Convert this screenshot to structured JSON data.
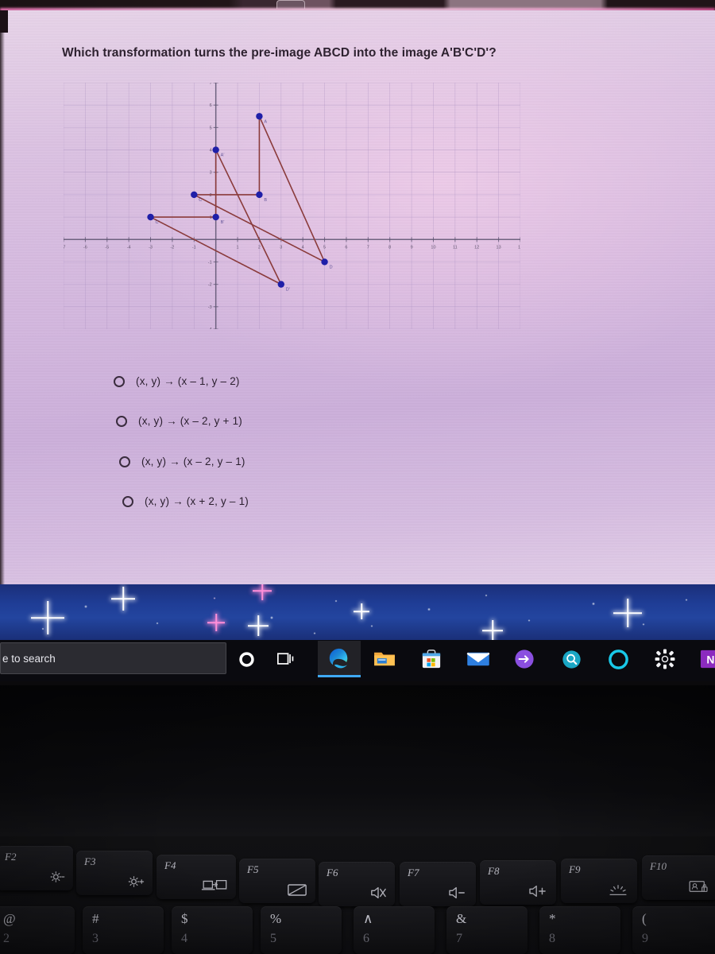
{
  "browser": {
    "tab_strip_visible": true
  },
  "question": {
    "title": "Which transformation turns the pre-image ABCD into the image A'B'C'D'?",
    "choices": [
      {
        "label": "(x, y) → (x – 1, y – 2)",
        "selected": false
      },
      {
        "label": "(x, y) → (x – 2, y + 1)",
        "selected": false
      },
      {
        "label": "(x, y) → (x – 2, y – 1)",
        "selected": false
      },
      {
        "label": "(x, y) → (x + 2, y – 1)",
        "selected": false
      }
    ]
  },
  "chart_data": {
    "type": "scatter",
    "title": "",
    "xlabel": "",
    "ylabel": "",
    "xlim": [
      -7,
      14
    ],
    "ylim": [
      -4,
      7
    ],
    "grid": true,
    "grid_step": 1,
    "legend": "none",
    "x_ticks": [
      -7,
      -6,
      -5,
      -4,
      -3,
      -2,
      -1,
      0,
      1,
      2,
      3,
      4,
      5,
      6,
      7,
      8,
      9,
      10,
      11,
      12,
      13,
      14
    ],
    "y_ticks": [
      -4,
      -3,
      -2,
      -1,
      0,
      1,
      2,
      3,
      4,
      5,
      6,
      7
    ],
    "point_color": "#1f1fa8",
    "segment_color": "#8a3b3b",
    "axis_color": "#5d5470",
    "grid_color": "#a98fc0",
    "series": [
      {
        "name": "pre-image ABCD",
        "points": [
          {
            "label": "A",
            "x": 2,
            "y": 5.5
          },
          {
            "label": "B",
            "x": 2,
            "y": 2
          },
          {
            "label": "C",
            "x": -1,
            "y": 2
          },
          {
            "label": "D",
            "x": 5,
            "y": -1
          }
        ],
        "edges": [
          [
            "A",
            "B"
          ],
          [
            "B",
            "C"
          ],
          [
            "A",
            "D"
          ],
          [
            "C",
            "D"
          ]
        ]
      },
      {
        "name": "image A'B'C'D'",
        "points": [
          {
            "label": "A'",
            "x": 0,
            "y": 4
          },
          {
            "label": "B'",
            "x": 0,
            "y": 1
          },
          {
            "label": "C'",
            "x": -3,
            "y": 1
          },
          {
            "label": "D'",
            "x": 3,
            "y": -2
          }
        ],
        "edges": [
          [
            "A'",
            "B'"
          ],
          [
            "B'",
            "C'"
          ],
          [
            "A'",
            "D'"
          ],
          [
            "C'",
            "D'"
          ]
        ]
      }
    ]
  },
  "taskbar": {
    "search_placeholder": "e to search",
    "search_value": "",
    "items": [
      {
        "name": "cortana-icon",
        "label": "Cortana"
      },
      {
        "name": "task-view-icon",
        "label": "Task View"
      },
      {
        "name": "edge-icon",
        "label": "Microsoft Edge"
      },
      {
        "name": "file-explorer-icon",
        "label": "File Explorer"
      },
      {
        "name": "microsoft-store-icon",
        "label": "Microsoft Store"
      },
      {
        "name": "mail-icon",
        "label": "Mail"
      },
      {
        "name": "sync-icon",
        "label": "Sync"
      },
      {
        "name": "search-magnifier-icon",
        "label": "Search"
      },
      {
        "name": "cortana-ring-icon",
        "label": "Cortana Ring"
      },
      {
        "name": "settings-gear-icon",
        "label": "Settings"
      },
      {
        "name": "onenote-icon",
        "label": "N"
      }
    ],
    "active_app": "Microsoft Edge"
  },
  "keyboard": {
    "function_keys": [
      {
        "key": "F2",
        "glyph": "brightness-down"
      },
      {
        "key": "F3",
        "glyph": "brightness-up"
      },
      {
        "key": "F4",
        "glyph": "display-switch"
      },
      {
        "key": "F5",
        "glyph": "touchpad-toggle"
      },
      {
        "key": "F6",
        "glyph": "volume-mute"
      },
      {
        "key": "F7",
        "glyph": "volume-down"
      },
      {
        "key": "F8",
        "glyph": "volume-up"
      },
      {
        "key": "F9",
        "glyph": "keyboard-backlight"
      },
      {
        "key": "F10",
        "glyph": "privacy-screen"
      }
    ],
    "number_row": [
      {
        "symbol": "@",
        "digit": "2"
      },
      {
        "symbol": "#",
        "digit": "3"
      },
      {
        "symbol": "$",
        "digit": "4"
      },
      {
        "symbol": "%",
        "digit": "5"
      },
      {
        "symbol": "∧",
        "digit": "6"
      },
      {
        "symbol": "&",
        "digit": "7"
      },
      {
        "symbol": "*",
        "digit": "8"
      },
      {
        "symbol": "(",
        "digit": "9"
      }
    ]
  },
  "colors": {
    "page_background": "#d5b8e0",
    "text": "#2c2030",
    "taskbar": "#0a0a0f",
    "wallpaper": "#1f3d96",
    "accent_blue": "#3fa9f5",
    "point_blue": "#1f1fa8",
    "segment_maroon": "#8a3b3b"
  }
}
